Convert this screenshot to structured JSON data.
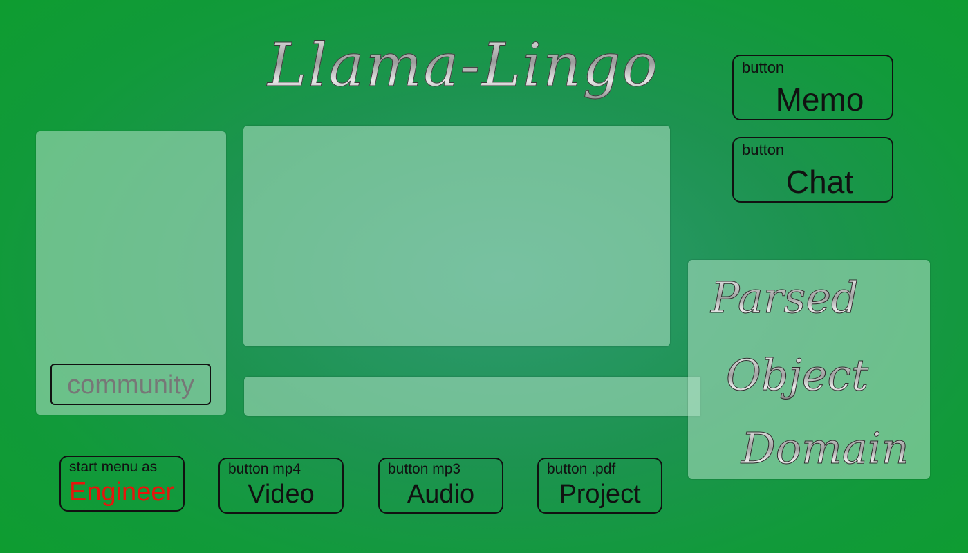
{
  "app": {
    "title": "Llama-Lingo"
  },
  "buttons": {
    "memo": {
      "caption": "button",
      "label": "Memo"
    },
    "chat": {
      "caption": "button",
      "label": "Chat"
    },
    "community": {
      "label": "community"
    },
    "engineer": {
      "caption": "start menu as",
      "label": "Engineer"
    },
    "video": {
      "caption": "button mp4",
      "label": "Video"
    },
    "audio": {
      "caption": "button mp3",
      "label": "Audio"
    },
    "project": {
      "caption": "button .pdf",
      "label": "Project"
    }
  },
  "pod_panel": {
    "lines": [
      "Parsed",
      "Object",
      "Domain"
    ]
  },
  "colors": {
    "background": "#119a3a",
    "panel": "#b4e1c8",
    "engineer_label": "#e8140c",
    "button_border": "#111111"
  }
}
